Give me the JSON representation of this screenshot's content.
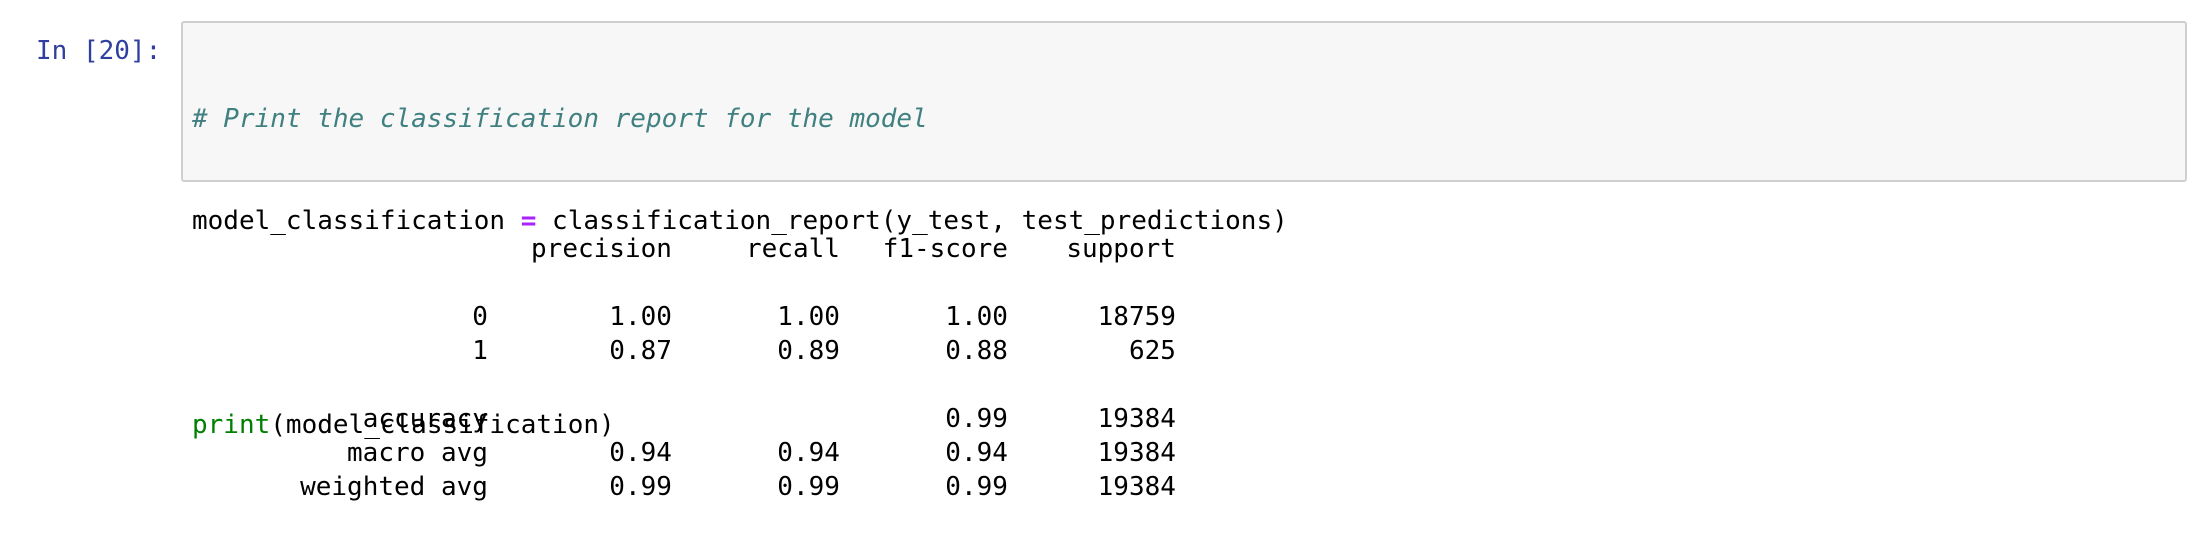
{
  "cell": {
    "prompt": "In [20]:",
    "code": {
      "comment": "# Print the classification report for the model",
      "assign_target": "model_classification ",
      "assign_op": "=",
      "assign_value": " classification_report(y_test, test_predictions)",
      "print_fn": "print",
      "print_args": "(model_classification)"
    },
    "output": {
      "headers": [
        "",
        "precision",
        "recall",
        "f1-score",
        "support"
      ],
      "class_rows": [
        [
          "0",
          "1.00",
          "1.00",
          "1.00",
          "18759"
        ],
        [
          "1",
          "0.87",
          "0.89",
          "0.88",
          "625"
        ]
      ],
      "summary_rows": [
        [
          "accuracy",
          "",
          "",
          "0.99",
          "19384"
        ],
        [
          "macro avg",
          "0.94",
          "0.94",
          "0.94",
          "19384"
        ],
        [
          "weighted avg",
          "0.99",
          "0.99",
          "0.99",
          "19384"
        ]
      ]
    }
  },
  "colors": {
    "prompt": "#303f9f",
    "comment": "#408080",
    "operator": "#aa22ff",
    "builtin": "#008000",
    "input_background": "#f7f7f7",
    "input_border": "#cfcfcf"
  }
}
